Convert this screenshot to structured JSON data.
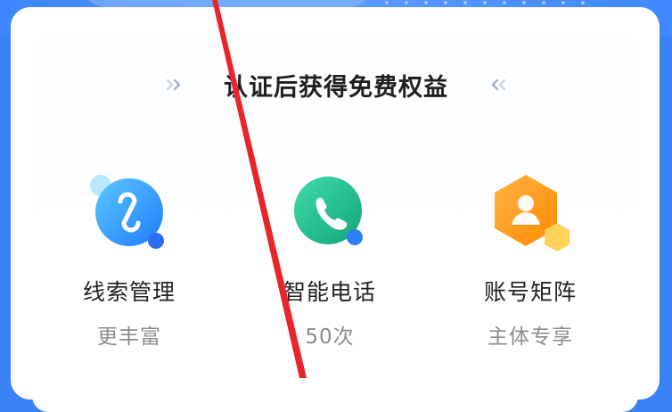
{
  "header": {
    "title": "认证后获得免费权益"
  },
  "benefits": [
    {
      "name": "线索管理",
      "sub": "更丰富",
      "icon": "clue-management-icon",
      "color": "#2f96ff"
    },
    {
      "name": "智能电话",
      "sub": "50次",
      "icon": "phone-icon",
      "color": "#1fbf8a"
    },
    {
      "name": "账号矩阵",
      "sub": "主体专享",
      "icon": "account-matrix-icon",
      "color": "#ff9a1f"
    }
  ],
  "colors": {
    "banner": "#3d86ff",
    "annotation_red": "#e8262a",
    "title_text": "#1f1f1f",
    "sub_text": "#8c8c8c"
  }
}
